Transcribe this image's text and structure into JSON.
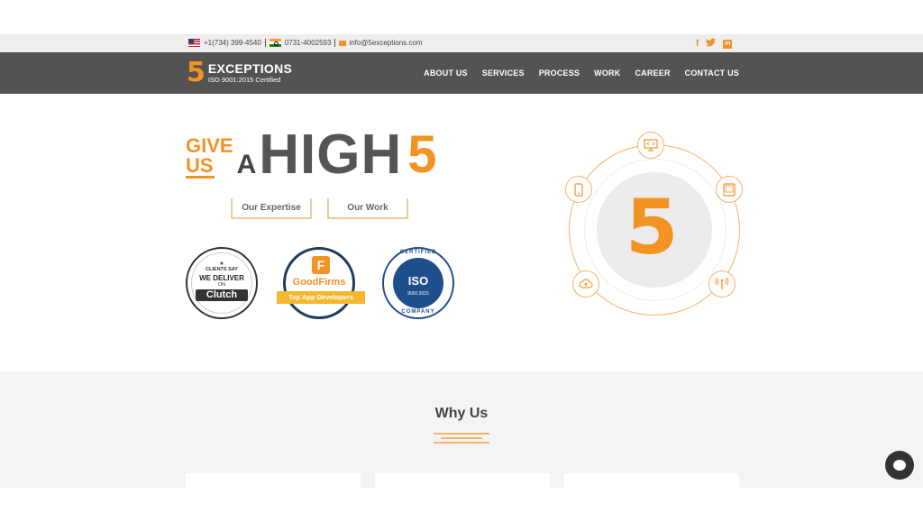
{
  "topbar": {
    "phone_us": "+1(734) 399-4540",
    "phone_in": "0731-4002593",
    "email": "info@5exceptions.com"
  },
  "social": {
    "facebook": "f",
    "twitter": "t",
    "linkedin": "in"
  },
  "brand": {
    "logo_digit": "5",
    "name": "EXCEPTIONS",
    "tagline": "ISO 9001:2015 Certified"
  },
  "nav": {
    "items": [
      "ABOUT US",
      "SERVICES",
      "PROCESS",
      "WORK",
      "CAREER",
      "CONTACT US"
    ]
  },
  "hero": {
    "give": "GIVE",
    "us": "US",
    "a": "A",
    "high": "HIGH",
    "five": "5",
    "btn_expertise": "Our Expertise",
    "btn_work": "Our Work"
  },
  "badges": {
    "clutch": {
      "star": "★",
      "line1": "CLIENTS SAY",
      "line2": "WE DELIVER",
      "line3": "ON",
      "brand": "Clutch"
    },
    "goodfirms": {
      "mark": "F",
      "brand": "GoodFirms",
      "ribbon": "Top App Developers"
    },
    "iso": {
      "top": "CERTIFIED",
      "mark": "ISO",
      "number": "9001:2015",
      "bottom": "COMPANY"
    }
  },
  "graphic": {
    "digit": "5",
    "icons": [
      "code-monitor-icon",
      "mobile-icon",
      "tablet-icon",
      "cloud-icon",
      "wifi-icon"
    ]
  },
  "why": {
    "title": "Why Us"
  },
  "colors": {
    "accent": "#f39323",
    "nav_bg": "#535353",
    "topbar_bg": "#eeeeee"
  }
}
